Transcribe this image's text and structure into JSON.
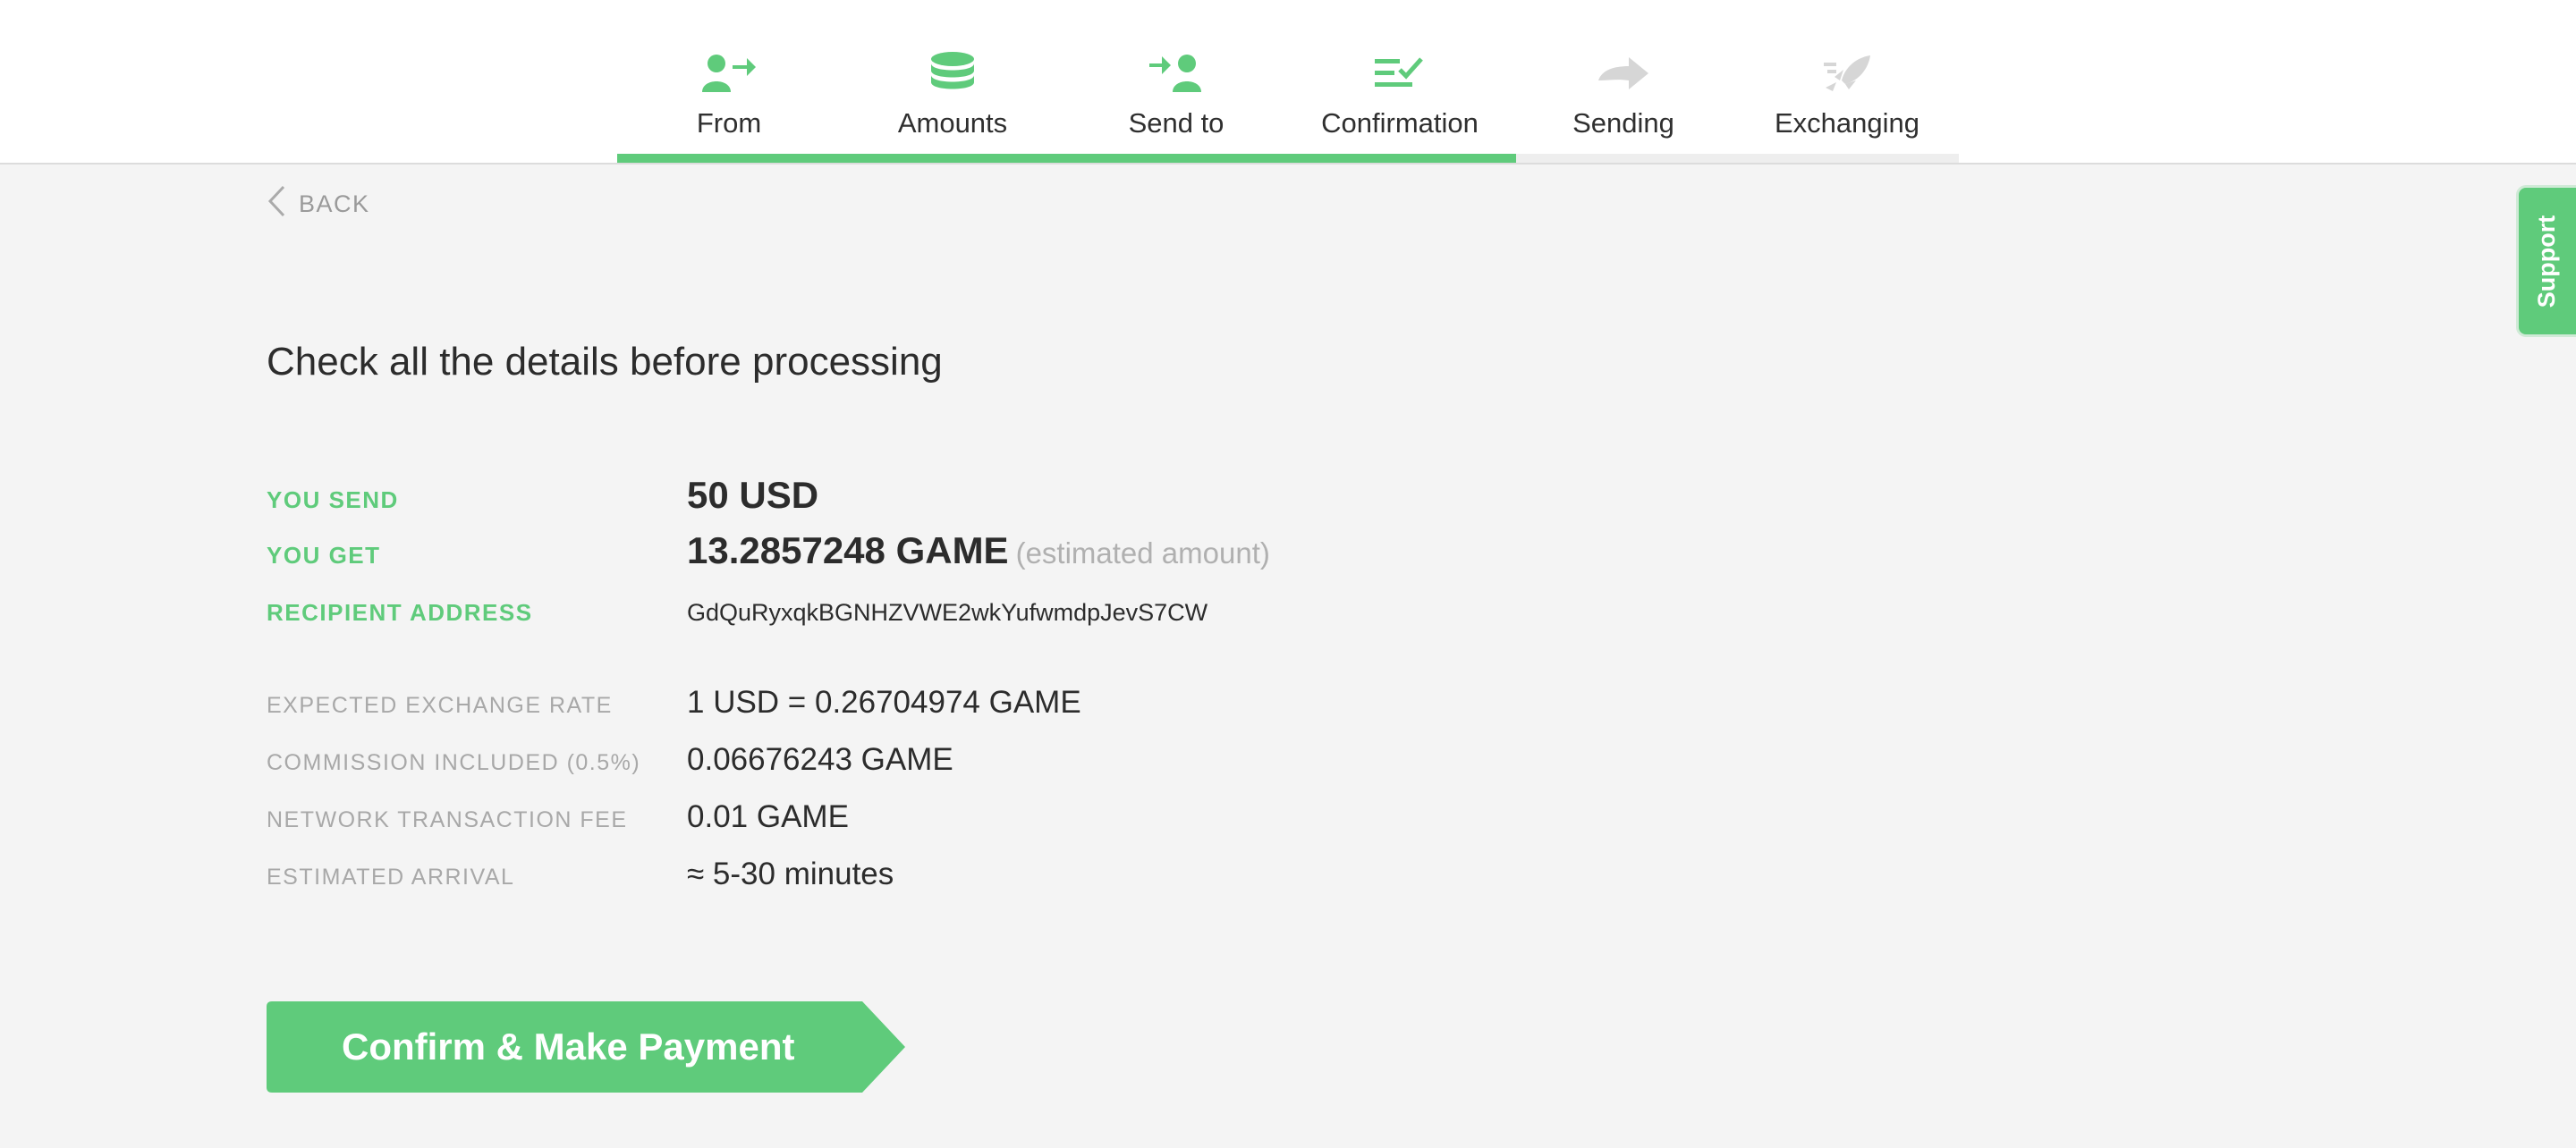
{
  "steps": [
    {
      "label": "From",
      "icon": "user-arrow-icon",
      "state": "done"
    },
    {
      "label": "Amounts",
      "icon": "coins-icon",
      "state": "done"
    },
    {
      "label": "Send to",
      "icon": "send-to-user-icon",
      "state": "done"
    },
    {
      "label": "Confirmation",
      "icon": "checklist-icon",
      "state": "active"
    },
    {
      "label": "Sending",
      "icon": "arrow-right-icon",
      "state": "pending"
    },
    {
      "label": "Exchanging",
      "icon": "rocket-icon",
      "state": "pending"
    }
  ],
  "progress": {
    "completed_fraction": 0.67
  },
  "back": {
    "label": "BACK"
  },
  "support": {
    "label": "Support"
  },
  "title": "Check all the details before processing",
  "details": {
    "send": {
      "label": "YOU SEND",
      "value": "50 USD"
    },
    "get": {
      "label": "YOU GET",
      "value": "13.2857248 GAME",
      "note": "(estimated amount)"
    },
    "recipient": {
      "label": "RECIPIENT ADDRESS",
      "value": "GdQuRyxqkBGNHZVWE2wkYufwmdpJevS7CW"
    },
    "rate": {
      "label": "EXPECTED EXCHANGE RATE",
      "value": "1 USD = 0.26704974 GAME"
    },
    "commission": {
      "label": "COMMISSION INCLUDED (0.5%)",
      "value": "0.06676243 GAME"
    },
    "fee": {
      "label": "NETWORK TRANSACTION FEE",
      "value": "0.01 GAME"
    },
    "arrival": {
      "label": "ESTIMATED ARRIVAL",
      "value": "≈ 5-30 minutes"
    }
  },
  "confirm": {
    "label": "Confirm & Make Payment"
  },
  "colors": {
    "accent": "#5fcb7b",
    "pending": "#d6d6d6",
    "text": "#2c2c2c",
    "muted": "#a8a8a8"
  }
}
